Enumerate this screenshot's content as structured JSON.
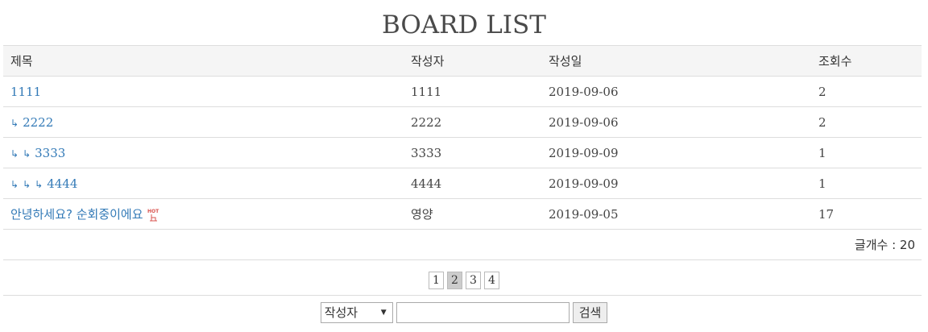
{
  "page_title": "BOARD LIST",
  "table": {
    "headers": [
      "제목",
      "작성자",
      "작성일",
      "조회수"
    ],
    "rows": [
      {
        "depth": 0,
        "title": "1111",
        "writer": "1111",
        "date": "2019-09-06",
        "views": "2",
        "hot": false
      },
      {
        "depth": 1,
        "title": "2222",
        "writer": "2222",
        "date": "2019-09-06",
        "views": "2",
        "hot": false
      },
      {
        "depth": 2,
        "title": "3333",
        "writer": "3333",
        "date": "2019-09-09",
        "views": "1",
        "hot": false
      },
      {
        "depth": 3,
        "title": "4444",
        "writer": "4444",
        "date": "2019-09-09",
        "views": "1",
        "hot": false
      },
      {
        "depth": 0,
        "title": "안녕하세요? 순회중이에요",
        "writer": "영양",
        "date": "2019-09-05",
        "views": "17",
        "hot": true
      }
    ],
    "reply_marker": "↳",
    "count_text": "글개수 : 20"
  },
  "pagination": {
    "pages": [
      "1",
      "2",
      "3",
      "4"
    ],
    "current": "2"
  },
  "search": {
    "field_selected": "작성자",
    "query": "",
    "button_label": "검색"
  },
  "colors": {
    "link": "#337ab7",
    "header_bg": "#f5f5f5",
    "border": "#dddddd",
    "active_page_bg": "#cccccc",
    "hot_icon": "#d9534f"
  },
  "icons": {
    "hot": "hot-badge-icon",
    "reply": "reply-arrow-icon",
    "dropdown": "caret-down-icon"
  }
}
